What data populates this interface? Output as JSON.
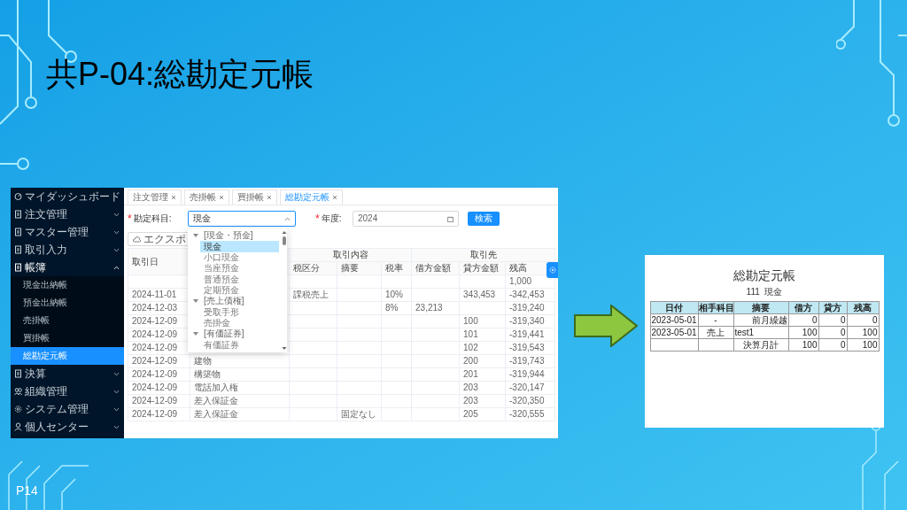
{
  "slide": {
    "title": "共P-04:総勘定元帳",
    "page": "P14"
  },
  "app": {
    "sidebar": {
      "items": [
        {
          "label": "マイダッシュボード"
        },
        {
          "label": "注文管理",
          "expanded": false
        },
        {
          "label": "マスター管理",
          "expanded": false
        },
        {
          "label": "取引入力",
          "expanded": false
        },
        {
          "label": "帳簿",
          "expanded": true,
          "children": [
            {
              "label": "現金出納帳",
              "selected": false
            },
            {
              "label": "預金出納帳",
              "selected": false
            },
            {
              "label": "売掛帳",
              "selected": false
            },
            {
              "label": "買掛帳",
              "selected": false
            },
            {
              "label": "総勘定元帳",
              "selected": true
            }
          ]
        },
        {
          "label": "決算",
          "expanded": false
        },
        {
          "label": "組織管理",
          "expanded": false
        },
        {
          "label": "システム管理",
          "expanded": false
        },
        {
          "label": "個人センター",
          "expanded": false
        }
      ]
    },
    "tabs": [
      {
        "label": "注文管理",
        "selected": false
      },
      {
        "label": "売掛帳",
        "selected": false
      },
      {
        "label": "買掛帳",
        "selected": false
      },
      {
        "label": "総勘定元帳",
        "selected": true
      }
    ],
    "filters": {
      "account": {
        "required_mark": "*",
        "label": "勘定科目:",
        "value": "現金"
      },
      "year": {
        "required_mark": "*",
        "label": "年度:",
        "value": "2024"
      },
      "search_button": "検索",
      "export_button": "エクスポ"
    },
    "dropdown": {
      "groups": [
        {
          "label": "[現金・預金]",
          "expanded": true,
          "children": [
            {
              "label": "現金",
              "selected": true
            },
            {
              "label": "小口現金",
              "selected": false
            },
            {
              "label": "当座預金",
              "selected": false
            },
            {
              "label": "普通預金",
              "selected": false
            },
            {
              "label": "定期預金",
              "selected": false
            }
          ]
        },
        {
          "label": "[売上債権]",
          "expanded": true,
          "children": [
            {
              "label": "受取手形",
              "selected": false
            },
            {
              "label": "売掛金",
              "selected": false
            }
          ]
        },
        {
          "label": "[有価証券]",
          "expanded": true,
          "children": [
            {
              "label": "有価証券",
              "selected": false
            }
          ]
        }
      ]
    },
    "table": {
      "group_headers": {
        "transaction": "取引内容",
        "counterparty": "取引先"
      },
      "columns": {
        "date": "取引日",
        "tax_category": "税区分",
        "description": "摘要",
        "tax_rate": "税率",
        "debit": "借方金額",
        "credit": "貸方金額",
        "balance": "残高"
      },
      "rows": [
        {
          "balance": "1,000"
        },
        {
          "date": "2024-11-01",
          "tax_category": "課税売上",
          "tax_rate": "10%",
          "credit": "343,453",
          "balance": "-342,453"
        },
        {
          "date": "2024-12-03",
          "tax_rate": "8%",
          "debit": "23,213",
          "balance": "-319,240"
        },
        {
          "date": "2024-12-09",
          "credit": "100",
          "balance": "-319,340"
        },
        {
          "date": "2024-12-09",
          "credit": "101",
          "balance": "-319,441"
        },
        {
          "date": "2024-12-09",
          "credit": "102",
          "balance": "-319,543"
        },
        {
          "date": "2024-12-09",
          "column_2": "建物",
          "credit": "200",
          "balance": "-319,743"
        },
        {
          "date": "2024-12-09",
          "column_2": "構築物",
          "credit": "201",
          "balance": "-319,944"
        },
        {
          "date": "2024-12-09",
          "column_2": "電話加入権",
          "credit": "203",
          "balance": "-320,147"
        },
        {
          "date": "2024-12-09",
          "column_2": "差入保証金",
          "credit": "203",
          "balance": "-320,350"
        },
        {
          "date": "2024-12-09",
          "column_2": "差入保証金",
          "description": "固定なし",
          "credit": "205",
          "balance": "-320,555"
        }
      ]
    }
  },
  "preview": {
    "title": "総勘定元帳",
    "subtitle": "111  現金",
    "columns": [
      "日付",
      "相手科目",
      "摘要",
      "借方",
      "貸方",
      "残高"
    ],
    "rows": [
      {
        "date": "2023-05-01",
        "account": "-",
        "kind": "carried_forward",
        "summary": "前月繰越",
        "debit": "0",
        "credit": "0",
        "balance": "0"
      },
      {
        "date": "2023-05-01",
        "account": "売上",
        "kind": "entry",
        "summary": "test1",
        "debit": "100",
        "credit": "0",
        "balance": "100"
      },
      {
        "kind": "total",
        "summary": "決算月計",
        "debit": "100",
        "credit": "0",
        "balance": "100"
      }
    ]
  }
}
